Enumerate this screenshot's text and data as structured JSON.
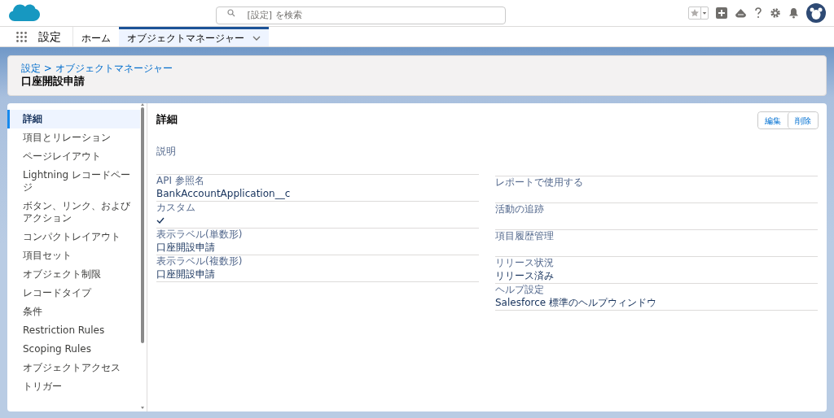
{
  "header": {
    "search": {
      "placeholder": "[設定] を検索"
    }
  },
  "nav": {
    "app_name": "設定",
    "tabs": [
      {
        "label": "ホーム",
        "selected": false,
        "has_menu": false
      },
      {
        "label": "オブジェクトマネージャー",
        "selected": true,
        "has_menu": true
      }
    ]
  },
  "page_header": {
    "breadcrumb": "設定 > オブジェクトマネージャー",
    "title": "口座開設申請"
  },
  "sidebar": {
    "items": [
      {
        "label": "詳細",
        "selected": true
      },
      {
        "label": "項目とリレーション",
        "selected": false
      },
      {
        "label": "ページレイアウト",
        "selected": false
      },
      {
        "label": "Lightning レコードページ",
        "selected": false
      },
      {
        "label": "ボタン、リンク、およびアクション",
        "selected": false
      },
      {
        "label": "コンパクトレイアウト",
        "selected": false
      },
      {
        "label": "項目セット",
        "selected": false
      },
      {
        "label": "オブジェクト制限",
        "selected": false
      },
      {
        "label": "レコードタイプ",
        "selected": false
      },
      {
        "label": "条件",
        "selected": false
      },
      {
        "label": "Restriction Rules",
        "selected": false
      },
      {
        "label": "Scoping Rules",
        "selected": false
      },
      {
        "label": "オブジェクトアクセス",
        "selected": false
      },
      {
        "label": "トリガー",
        "selected": false
      }
    ]
  },
  "detail": {
    "title": "詳細",
    "buttons": [
      "編集",
      "削除"
    ],
    "left_fields": [
      {
        "kind": "text",
        "label": "説明"
      },
      {
        "kind": "text",
        "label": "API 参照名",
        "value": "BankAccountApplication__c"
      },
      {
        "kind": "checkbox",
        "label": "カスタム",
        "checked": true
      },
      {
        "kind": "text",
        "label": "表示ラベル(単数形)",
        "value": "口座開設申請"
      },
      {
        "kind": "text",
        "label": "表示ラベル(複数形)",
        "value": "口座開設申請"
      }
    ],
    "right_fields": [
      {
        "kind": "blank"
      },
      {
        "kind": "checkbox",
        "label": "レポートで使用する",
        "checked": false
      },
      {
        "kind": "checkbox",
        "label": "活動の追跡",
        "checked": false
      },
      {
        "kind": "checkbox",
        "label": "項目履歴管理",
        "checked": false
      },
      {
        "kind": "text",
        "label": "リリース状況",
        "value": "リリース済み"
      },
      {
        "kind": "text",
        "label": "ヘルプ設定",
        "value": "Salesforce 標準のヘルプウィンドウ"
      }
    ]
  }
}
